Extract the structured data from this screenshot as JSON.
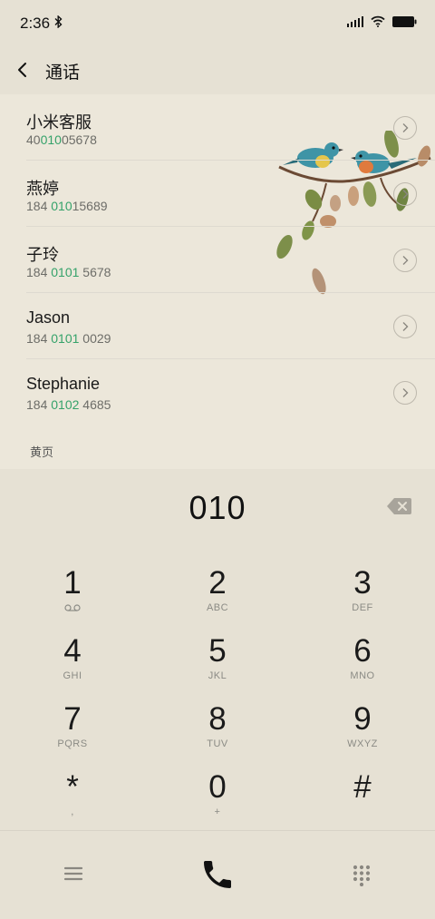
{
  "status_bar": {
    "time": "2:36"
  },
  "header": {
    "title": "通话"
  },
  "contacts": [
    {
      "name": "小米客服",
      "number_pre": "40",
      "number_match": "010",
      "number_post": "05678"
    },
    {
      "name": "燕婷",
      "number_pre": "184 ",
      "number_match": "010",
      "number_post": "15689"
    },
    {
      "name": "子玲",
      "number_pre": "184 ",
      "number_match": "0101",
      "number_post": " 5678"
    },
    {
      "name": "Jason",
      "number_pre": "184 ",
      "number_match": "0101",
      "number_post": " 0029"
    },
    {
      "name": "Stephanie",
      "number_pre": "184 ",
      "number_match": "0102",
      "number_post": " 4685"
    }
  ],
  "section_label": "黄页",
  "dial": {
    "digits": "010"
  },
  "keypad": [
    {
      "digit": "1",
      "letters": ""
    },
    {
      "digit": "2",
      "letters": "ABC"
    },
    {
      "digit": "3",
      "letters": "DEF"
    },
    {
      "digit": "4",
      "letters": "GHI"
    },
    {
      "digit": "5",
      "letters": "JKL"
    },
    {
      "digit": "6",
      "letters": "MNO"
    },
    {
      "digit": "7",
      "letters": "PQRS"
    },
    {
      "digit": "8",
      "letters": "TUV"
    },
    {
      "digit": "9",
      "letters": "WXYZ"
    },
    {
      "digit": "*",
      "letters": ","
    },
    {
      "digit": "0",
      "letters": "+"
    },
    {
      "digit": "#",
      "letters": ""
    }
  ],
  "icons": {
    "bluetooth": "bluetooth-icon",
    "signal": "signal-icon",
    "wifi": "wifi-icon",
    "battery": "battery-icon",
    "back": "back-icon",
    "chevron": "chevron-right-icon",
    "backspace": "backspace-icon",
    "voicemail": "voicemail-icon",
    "menu": "menu-icon",
    "call": "phone-icon",
    "dialpad": "dialpad-icon"
  },
  "colors": {
    "background": "#e6e1d4",
    "list_background": "#ece7da",
    "match_highlight": "#35a26a"
  }
}
